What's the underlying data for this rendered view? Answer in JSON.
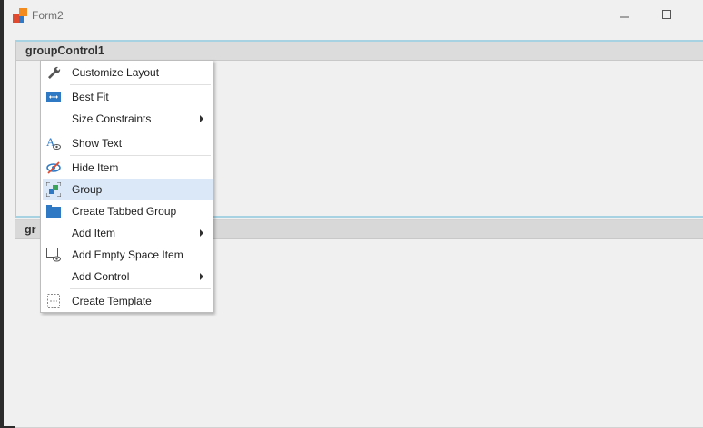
{
  "window": {
    "title": "Form2"
  },
  "groups": [
    {
      "title": "groupControl1"
    },
    {
      "title": "gr"
    }
  ],
  "context_menu": {
    "items": [
      {
        "label": "Customize Layout",
        "icon": "wrench-icon",
        "submenu": false
      },
      {
        "label": "Best Fit",
        "icon": "best-fit-icon",
        "submenu": false
      },
      {
        "label": "Size Constraints",
        "icon": "",
        "submenu": true
      },
      {
        "label": "Show Text",
        "icon": "show-text-icon",
        "submenu": false
      },
      {
        "label": "Hide Item",
        "icon": "hide-item-icon",
        "submenu": false
      },
      {
        "label": "Group",
        "icon": "group-icon",
        "submenu": false,
        "highlighted": true
      },
      {
        "label": "Create Tabbed Group",
        "icon": "tabbed-group-icon",
        "submenu": false
      },
      {
        "label": "Add Item",
        "icon": "",
        "submenu": true
      },
      {
        "label": "Add Empty Space Item",
        "icon": "empty-space-icon",
        "submenu": false
      },
      {
        "label": "Add Control",
        "icon": "",
        "submenu": true
      },
      {
        "label": "Create Template",
        "icon": "template-icon",
        "submenu": false
      }
    ]
  },
  "colors": {
    "highlight": "#dbe8f8",
    "group_border": "#a6d2e2",
    "accent_blue": "#2f78c4"
  }
}
